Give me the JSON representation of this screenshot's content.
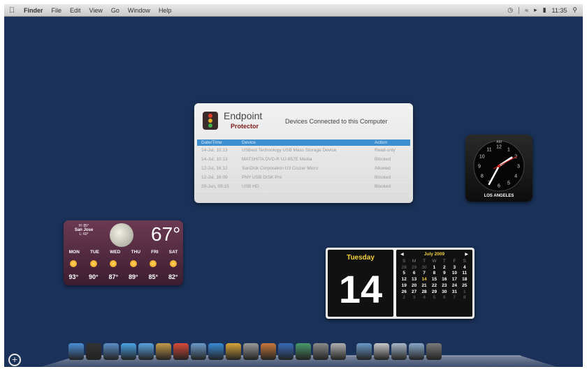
{
  "menubar": {
    "apple": "",
    "items": [
      "Finder",
      "File",
      "Edit",
      "View",
      "Go",
      "Window",
      "Help"
    ],
    "time": "11:35"
  },
  "endpoint": {
    "brand": "Endpoint",
    "brand2": "Protector",
    "title": "Devices Connected to this Computer",
    "columns": [
      "Date/Time",
      "Device",
      "Action"
    ],
    "rows": [
      [
        "14-Jul, 10:13",
        "USBest Technology USB Mass Storage Device",
        "Read-only"
      ],
      [
        "14-Jul, 10:13",
        "MATSHITA DVD-R UJ-857E Media",
        "Blocked"
      ],
      [
        "12-Jul, 16:12",
        "SanDisk Corporation U3 Cruzer Micro",
        "Allowed"
      ],
      [
        "12-Jul, 16:09",
        "PNY USB DISK Pro",
        "Blocked"
      ],
      [
        "29-Jun, 09:15",
        "USB HD",
        "Blocked"
      ]
    ]
  },
  "clock": {
    "label": "AM",
    "city": "LOS ANGELES",
    "numbers": [
      "12",
      "1",
      "2",
      "3",
      "4",
      "5",
      "6",
      "7",
      "8",
      "9",
      "10",
      "11"
    ]
  },
  "weather": {
    "hi": "H: 85°",
    "city": "San Jose",
    "lo": "L: 60°",
    "temp": "67°",
    "days": [
      "MON",
      "TUE",
      "WED",
      "THU",
      "FRI",
      "SAT"
    ],
    "temps": [
      "93°",
      "90°",
      "87°",
      "89°",
      "85°",
      "82°"
    ]
  },
  "calendar": {
    "day_name": "Tuesday",
    "day_number": "14",
    "month": "July 2009",
    "prev": "◀",
    "next": "▶",
    "headers": [
      "S",
      "M",
      "T",
      "W",
      "T",
      "F",
      "S"
    ],
    "cells": [
      [
        "28",
        "dim"
      ],
      [
        "29",
        "dim"
      ],
      [
        "30",
        "dim"
      ],
      [
        "1",
        ""
      ],
      [
        "2",
        ""
      ],
      [
        "3",
        ""
      ],
      [
        "4",
        ""
      ],
      [
        "5",
        ""
      ],
      [
        "6",
        ""
      ],
      [
        "7",
        ""
      ],
      [
        "8",
        ""
      ],
      [
        "9",
        ""
      ],
      [
        "10",
        ""
      ],
      [
        "11",
        ""
      ],
      [
        "12",
        ""
      ],
      [
        "13",
        ""
      ],
      [
        "14",
        "today"
      ],
      [
        "15",
        ""
      ],
      [
        "16",
        ""
      ],
      [
        "17",
        ""
      ],
      [
        "18",
        ""
      ],
      [
        "19",
        ""
      ],
      [
        "20",
        ""
      ],
      [
        "21",
        ""
      ],
      [
        "22",
        ""
      ],
      [
        "23",
        ""
      ],
      [
        "24",
        ""
      ],
      [
        "25",
        ""
      ],
      [
        "26",
        ""
      ],
      [
        "27",
        ""
      ],
      [
        "28",
        ""
      ],
      [
        "29",
        ""
      ],
      [
        "30",
        ""
      ],
      [
        "31",
        ""
      ],
      [
        "1",
        "dim"
      ],
      [
        "2",
        "dim"
      ],
      [
        "3",
        "dim"
      ],
      [
        "4",
        "dim"
      ],
      [
        "5",
        "dim"
      ],
      [
        "6",
        "dim"
      ],
      [
        "7",
        "dim"
      ],
      [
        "8",
        "dim"
      ]
    ]
  },
  "dock": {
    "icons": [
      {
        "name": "finder-icon",
        "color": "#4a8fd6"
      },
      {
        "name": "dashboard-icon",
        "color": "#333333"
      },
      {
        "name": "preview-icon",
        "color": "#5b8fc8"
      },
      {
        "name": "safari-icon",
        "color": "#4aa3e6"
      },
      {
        "name": "ichat-icon",
        "color": "#59a3e0"
      },
      {
        "name": "address-book-icon",
        "color": "#c49a4a"
      },
      {
        "name": "ical-icon",
        "color": "#d84a3a"
      },
      {
        "name": "iphoto-icon",
        "color": "#6c9bc8"
      },
      {
        "name": "itunes-icon",
        "color": "#3a8ad6"
      },
      {
        "name": "imovie-icon",
        "color": "#d8a63a"
      },
      {
        "name": "iweb-icon",
        "color": "#9a9a9a"
      },
      {
        "name": "garageband-icon",
        "color": "#c8783a"
      },
      {
        "name": "spaces-icon",
        "color": "#3a6ab8"
      },
      {
        "name": "time-machine-icon",
        "color": "#4a9a6a"
      },
      {
        "name": "system-preferences-icon",
        "color": "#8a8a8a"
      },
      {
        "name": "script-editor-icon",
        "color": "#b0b0b0"
      },
      {
        "name": "applications-folder-icon",
        "color": "#6a9ac8"
      },
      {
        "name": "documents-stack-icon",
        "color": "#c8c8c8"
      },
      {
        "name": "downloads-stack-icon",
        "color": "#a8b8c8"
      },
      {
        "name": "folder-icon",
        "color": "#88a8c8"
      },
      {
        "name": "trash-icon",
        "color": "#7a7a7a"
      }
    ]
  },
  "add_widget": "+"
}
